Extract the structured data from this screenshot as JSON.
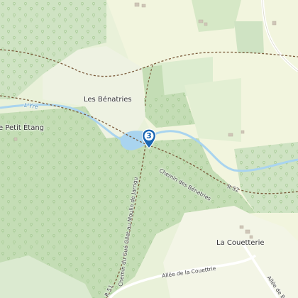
{
  "map": {
    "labels": {
      "les_benatries": "Les Bénatries",
      "le_petit_etang": "e Petit Étang",
      "riviere": "L'Yre",
      "chemin_benatries": "Chemin des Bénatries",
      "chemin_gue_gilet": "Chemin du Gué Gilet au Moulin de Jarrigu",
      "la_couetterie": "La Couetterie",
      "allee_couettrie": "Allée de la Couettrie",
      "allee_breng": "Allée de Breng",
      "road_r52": "R 52",
      "road_r51": "R 51"
    },
    "marker": {
      "number": "3"
    },
    "colors": {
      "forest": "#cfe3c3",
      "forest_dark": "#b9d7ab",
      "meadow": "#e9f1d9",
      "field": "#f3f5e2",
      "water": "#a9d4ef",
      "track": "#7a5a3a",
      "marker": "#1a66b2"
    }
  }
}
